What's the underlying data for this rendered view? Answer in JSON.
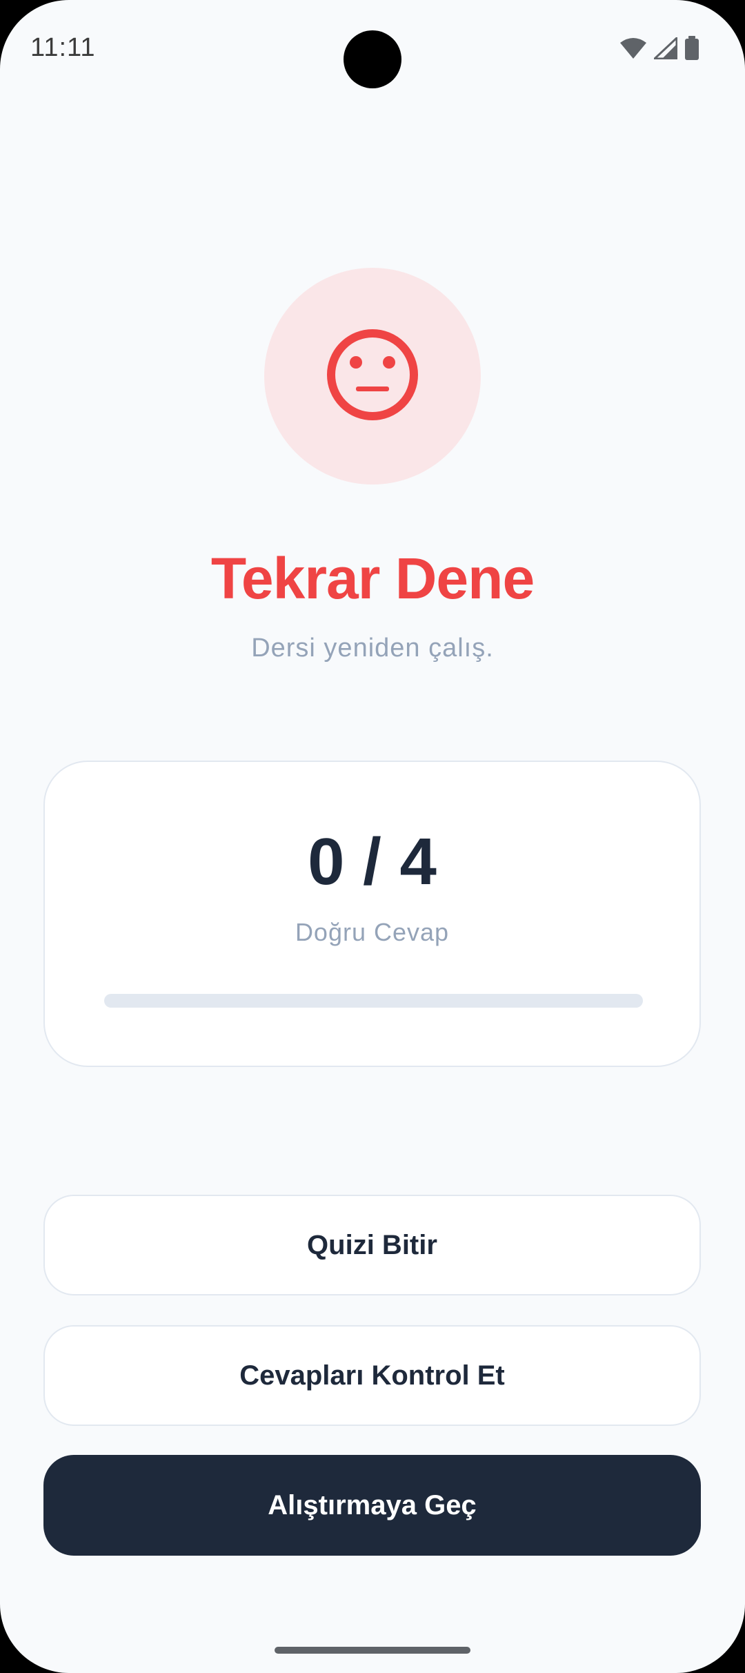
{
  "status_bar": {
    "time": "11:11",
    "icons": [
      "wifi-icon",
      "cellular-signal-icon",
      "battery-icon"
    ]
  },
  "result": {
    "icon": "neutral-face-icon",
    "title": "Tekrar Dene",
    "subtitle": "Dersi yeniden çalış.",
    "accent_color": "#ef4444",
    "icon_background": "#fae6e8"
  },
  "score": {
    "value": "0 / 4",
    "label": "Doğru Cevap",
    "correct": 0,
    "total": 4,
    "progress_fraction": 0
  },
  "actions": {
    "finish_label": "Quizi Bitir",
    "check_label": "Cevapları Kontrol Et",
    "practice_label": "Alıştırmaya Geç"
  },
  "colors": {
    "background": "#f8fafc",
    "text_primary": "#1e293b",
    "text_muted": "#94a3b8",
    "border": "#e2e8f0"
  }
}
